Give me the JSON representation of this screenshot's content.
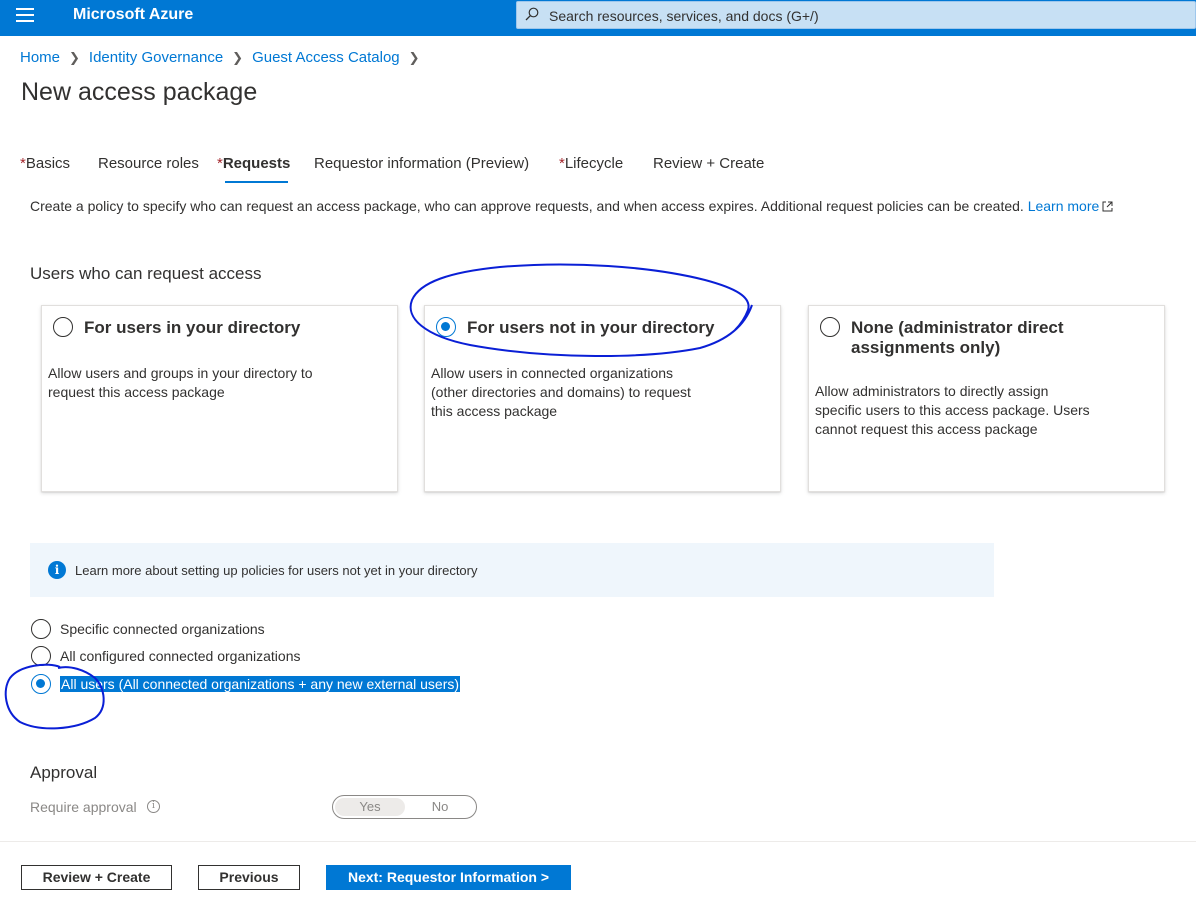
{
  "app": {
    "brand": "Microsoft Azure"
  },
  "search": {
    "placeholder": "Search resources, services, and docs (G+/)"
  },
  "breadcrumb": [
    "Home",
    "Identity Governance",
    "Guest Access Catalog"
  ],
  "page_title": "New access package",
  "tabs": [
    {
      "label": "Basics",
      "required": true,
      "active": false
    },
    {
      "label": "Resource roles",
      "required": false,
      "active": false
    },
    {
      "label": "Requests",
      "required": true,
      "active": true
    },
    {
      "label": "Requestor information (Preview)",
      "required": false,
      "active": false
    },
    {
      "label": "Lifecycle",
      "required": true,
      "active": false
    },
    {
      "label": "Review + Create",
      "required": false,
      "active": false
    }
  ],
  "required_marker": "*",
  "description": {
    "text": "Create a policy to specify who can request an access package, who can approve requests, and when access expires. Additional request policies can be created.",
    "link": "Learn more"
  },
  "users_section": {
    "title": "Users who can request access",
    "options": [
      {
        "title": "For users in your directory",
        "desc": "Allow users and groups in your directory to request this access package",
        "selected": false
      },
      {
        "title": "For users not in your directory",
        "desc": "Allow users in connected organizations (other directories and domains) to request this access package",
        "selected": true
      },
      {
        "title": "None (administrator direct assignments only)",
        "desc": "Allow administrators to directly assign specific users to this access package. Users cannot request this access package",
        "selected": false
      }
    ]
  },
  "info_bar": {
    "icon": "info-icon",
    "text": "Learn more about setting up policies for users not yet in your directory"
  },
  "scope_options": [
    {
      "label": "Specific connected organizations",
      "selected": false
    },
    {
      "label": "All configured connected organizations",
      "selected": false
    },
    {
      "label": "All users (All connected organizations + any new external users)",
      "selected": true
    }
  ],
  "approval": {
    "title": "Approval",
    "require_label": "Require approval",
    "toggle_yes": "Yes",
    "toggle_no": "No"
  },
  "footer": {
    "review_create": "Review + Create",
    "previous": "Previous",
    "next": "Next: Requestor Information >"
  },
  "colors": {
    "accent": "#0078d4",
    "topbar": "#0078d4",
    "required": "#a4262c",
    "annotation": "#0a1fd6"
  }
}
